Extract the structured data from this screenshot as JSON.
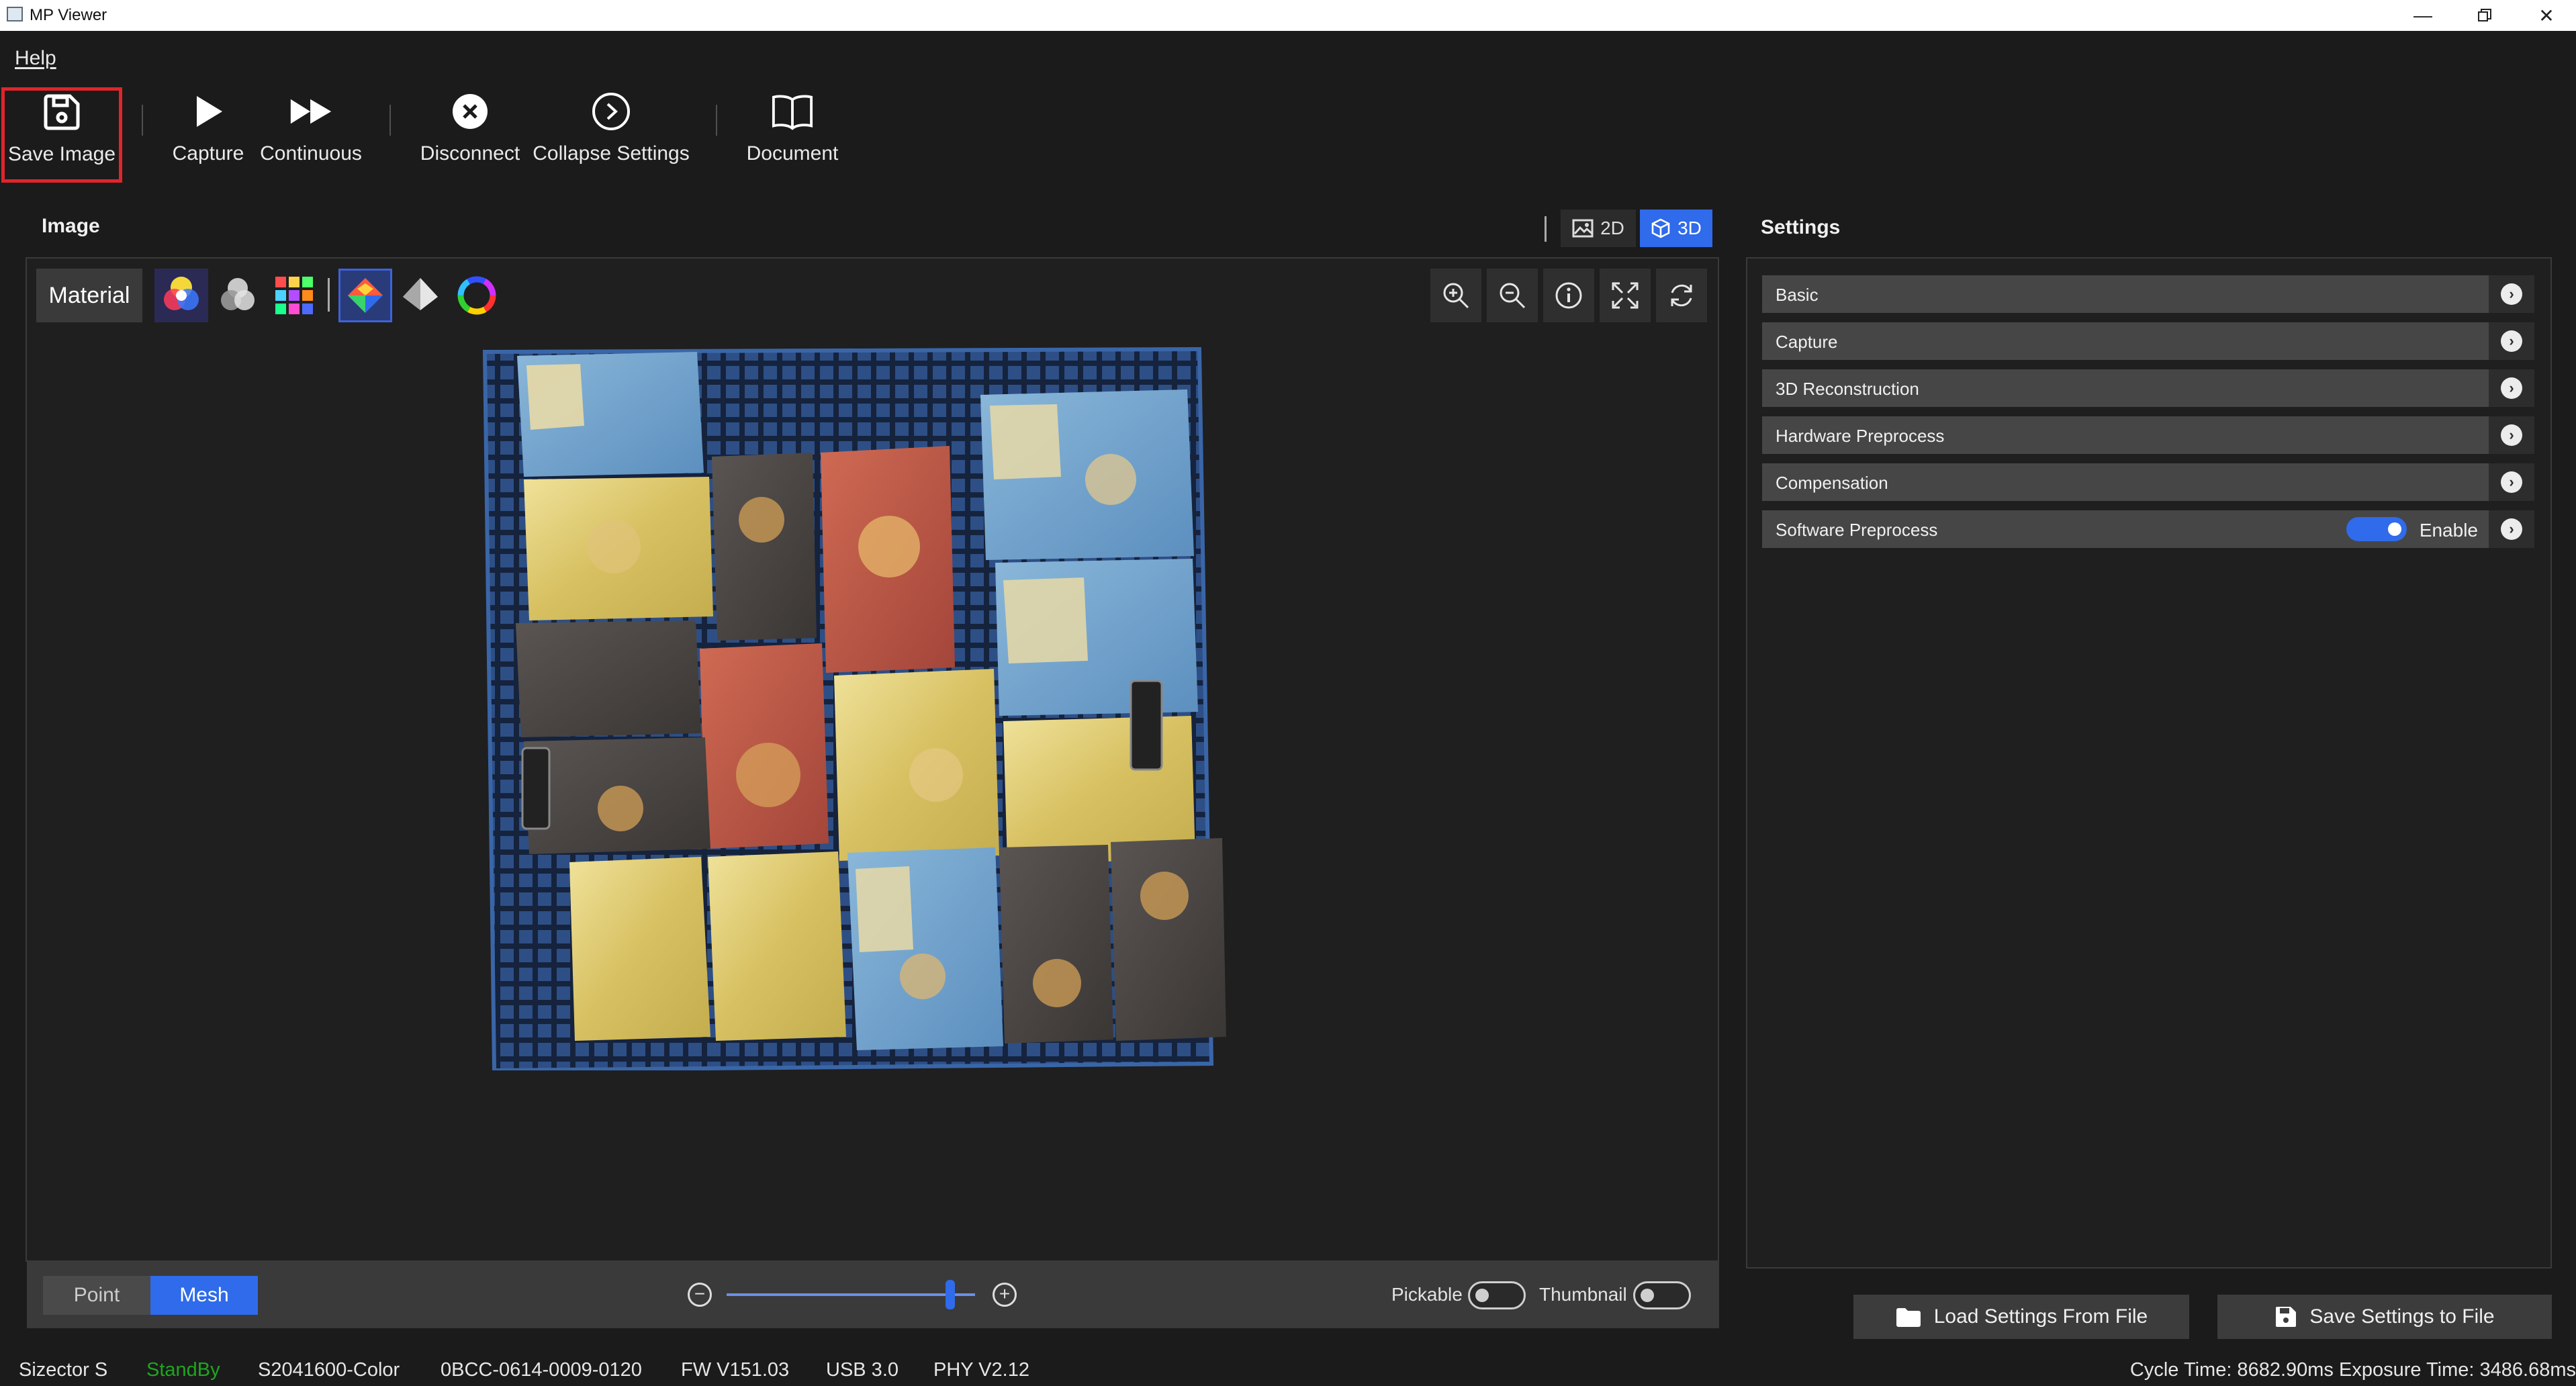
{
  "window": {
    "title": "MP Viewer"
  },
  "menu": {
    "help": "Help"
  },
  "toolbar": {
    "save_image": "Save Image",
    "capture": "Capture",
    "continuous": "Continuous",
    "disconnect": "Disconnect",
    "collapse_settings": "Collapse Settings",
    "document": "Document"
  },
  "image_panel": {
    "title": "Image",
    "view_2d": "2D",
    "view_3d": "3D",
    "active_view": "3D",
    "material": "Material",
    "point": "Point",
    "mesh": "Mesh",
    "active_render": "Mesh",
    "pickable": "Pickable",
    "thumbnail": "Thumbnail",
    "pickable_on": false,
    "thumbnail_on": false,
    "zoom_slider_value": 0.9
  },
  "settings": {
    "title": "Settings",
    "sections": [
      "Basic",
      "Capture",
      "3D Reconstruction",
      "Hardware Preprocess",
      "Compensation",
      "Software Preprocess"
    ],
    "software_preprocess_enable_label": "Enable",
    "software_preprocess_enabled": true,
    "load_button": "Load Settings From File",
    "save_button": "Save Settings to File"
  },
  "status": {
    "device": "Sizector S",
    "state": "StandBy",
    "state_color": "#1fa51f",
    "model": "S2041600-Color",
    "serial": "0BCC-0614-0009-0120",
    "fw": "FW V151.03",
    "usb": "USB 3.0",
    "phy": "PHY V2.12",
    "timing": "Cycle Time: 8682.90ms Exposure Time: 3486.68ms"
  },
  "colors": {
    "accent": "#2f6bea",
    "highlight": "#e0252b"
  }
}
